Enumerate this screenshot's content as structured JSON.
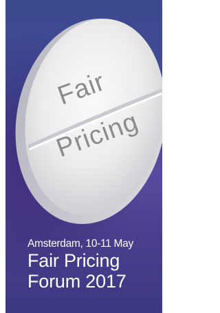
{
  "pill": {
    "line1": "Fair",
    "line2": "Pricing"
  },
  "caption": {
    "subtitle": "Amsterdam, 10-11 May",
    "title_line1": "Fair Pricing",
    "title_line2": "Forum 2017"
  },
  "colors": {
    "background": "#444a97",
    "pill": "#e6e6e6",
    "pill_text": "#8c8c8c",
    "caption_text": "#ffffff"
  }
}
